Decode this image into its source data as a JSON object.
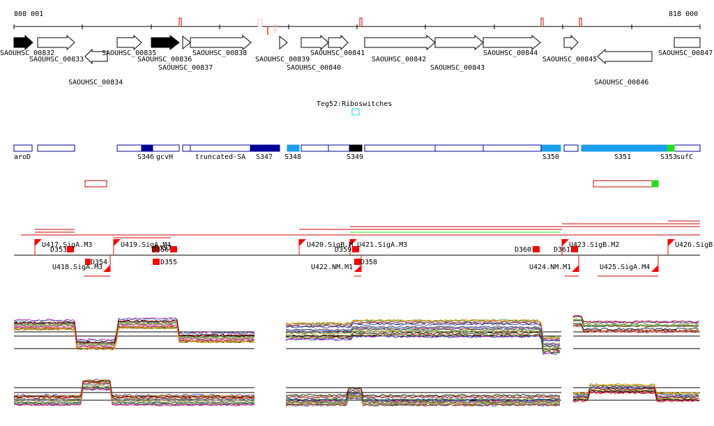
{
  "ruler": {
    "start_label": "808 001",
    "end_label": "818 000"
  },
  "tracks": {
    "genes": [
      {
        "name": "SAOUHSC_00832",
        "strand": "+",
        "fill": "black"
      },
      {
        "name": "SAOUHSC_00833",
        "strand": "+",
        "fill": "white"
      },
      {
        "name": "SAOUHSC_00834",
        "strand": "-",
        "fill": "white"
      },
      {
        "name": "SAOUHSC_00835",
        "strand": "+",
        "fill": "white"
      },
      {
        "name": "SAOUHSC_00836",
        "strand": "+",
        "fill": "black"
      },
      {
        "name": "SAOUHSC_00837",
        "strand": "+",
        "fill": "white"
      },
      {
        "name": "SAOUHSC_00838",
        "strand": "+",
        "fill": "white"
      },
      {
        "name": "SAOUHSC_00839",
        "strand": "+",
        "fill": "white"
      },
      {
        "name": "SAOUHSC_00840",
        "strand": "+",
        "fill": "white"
      },
      {
        "name": "SAOUHSC_00841",
        "strand": "+",
        "fill": "white"
      },
      {
        "name": "SAOUHSC_00842",
        "strand": "+",
        "fill": "white"
      },
      {
        "name": "SAOUHSC_00843",
        "strand": "+",
        "fill": "white"
      },
      {
        "name": "SAOUHSC_00844",
        "strand": "+",
        "fill": "white"
      },
      {
        "name": "SAOUHSC_00845",
        "strand": "+",
        "fill": "white"
      },
      {
        "name": "SAOUHSC_00846",
        "strand": "-",
        "fill": "white"
      },
      {
        "name": "SAOUHSC_00847",
        "strand": "+",
        "fill": "white"
      }
    ],
    "riboswitch_label": "Teg52:Riboswitches",
    "segment_labels": [
      "aroD",
      "S346",
      "gcvH",
      "truncated-SA",
      "S347",
      "S348",
      "S349",
      "S350",
      "S351",
      "S353",
      "sufC"
    ],
    "promoters_top": [
      "U417.SigA.M3",
      "U419.SigA.M4",
      "U420.SigB.M",
      "U421.SigA.M3",
      "U423.SigB.M2",
      "U426.SigB."
    ],
    "promoters_bottom": [
      "U418.SigA.M3",
      "U422.NM.M1",
      "U424.NM.M1",
      "U425.SigA.M4"
    ],
    "terminators": [
      "D353",
      "D356",
      "D357",
      "D354",
      "D355",
      "D359",
      "D358",
      "D360",
      "D361"
    ]
  },
  "colors": {
    "red": "#ff0000",
    "dark_red": "#cc0000",
    "navy": "#000099",
    "light_blue": "#1a9ff0",
    "cyan": "#00e5e5",
    "green": "#22dd22"
  }
}
